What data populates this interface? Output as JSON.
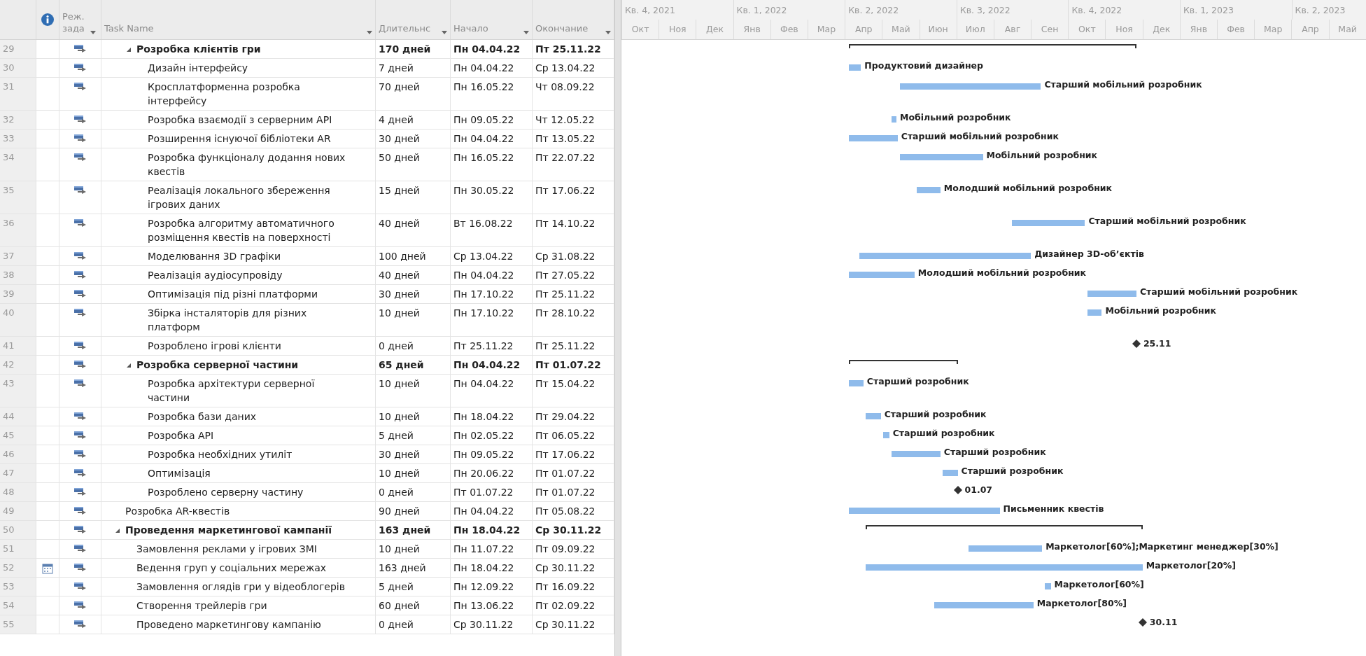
{
  "table": {
    "columns": [
      {
        "label": "Реж. зада",
        "dropdown": true
      },
      {
        "label": "Task Name",
        "dropdown": true
      },
      {
        "label": "Длительнс",
        "dropdown": true
      },
      {
        "label": "Начало",
        "dropdown": true
      },
      {
        "label": "Окончание",
        "dropdown": true
      }
    ]
  },
  "timeline": {
    "quarters": [
      "Кв. 4, 2021",
      "Кв. 1, 2022",
      "Кв. 2, 2022",
      "Кв. 3, 2022",
      "Кв. 4, 2022",
      "Кв. 1, 2023",
      "Кв. 2, 2023"
    ],
    "months": [
      "Окт",
      "Ноя",
      "Дек",
      "Янв",
      "Фев",
      "Мар",
      "Апр",
      "Май",
      "Июн",
      "Июл",
      "Авг",
      "Сен",
      "Окт",
      "Ноя",
      "Дек",
      "Янв",
      "Фев",
      "Мар",
      "Апр",
      "Май"
    ]
  },
  "tasks": [
    {
      "id": "29",
      "kind": "sub_summary",
      "expanded": true,
      "name": "Розробка клієнтів гри",
      "duration": "170 дней",
      "start": "Пн 04.04.22",
      "finish": "Пт 25.11.22",
      "children": [
        {
          "id": "30",
          "kind": "task",
          "name": "Дизайн інтерфейсу",
          "duration": "7 дней",
          "start": "Пн 04.04.22",
          "finish": "Ср 13.04.22",
          "bar_label": "Продуктовий дизайнер"
        },
        {
          "id": "31",
          "kind": "task",
          "name": "Кросплатформенна розробка інтерфейсу",
          "duration": "70 дней",
          "start": "Пн 16.05.22",
          "finish": "Чт 08.09.22",
          "bar_label": "Старший мобільний розробник"
        },
        {
          "id": "32",
          "kind": "task",
          "name": "Розробка взаємодії з серверним API",
          "duration": "4 дней",
          "start": "Пн 09.05.22",
          "finish": "Чт 12.05.22",
          "bar_label": "Мобільний розробник"
        },
        {
          "id": "33",
          "kind": "task",
          "name": "Розширення існуючої бібліотеки AR",
          "duration": "30 дней",
          "start": "Пн 04.04.22",
          "finish": "Пт 13.05.22",
          "bar_label": "Старший мобільний розробник"
        },
        {
          "id": "34",
          "kind": "task",
          "name": "Розробка функціоналу додання нових квестів",
          "duration": "50 дней",
          "start": "Пн 16.05.22",
          "finish": "Пт 22.07.22",
          "bar_label": "Мобільний розробник"
        },
        {
          "id": "35",
          "kind": "task",
          "name": "Реалізація локального збереження ігрових даних",
          "duration": "15 дней",
          "start": "Пн 30.05.22",
          "finish": "Пт 17.06.22",
          "bar_label": "Молодший мобільний розробник"
        },
        {
          "id": "36",
          "kind": "task",
          "name": "Розробка алгоритму автоматичного розміщення квестів на поверхності",
          "duration": "40 дней",
          "start": "Вт 16.08.22",
          "finish": "Пт 14.10.22",
          "bar_label": "Старший мобільний розробник"
        },
        {
          "id": "37",
          "kind": "task",
          "name": "Моделювання 3D графіки",
          "duration": "100 дней",
          "start": "Ср 13.04.22",
          "finish": "Ср 31.08.22",
          "bar_label": "Дизайнер 3D-об’єктів"
        },
        {
          "id": "38",
          "kind": "task",
          "name": "Реалізація аудіосупровіду",
          "duration": "40 дней",
          "start": "Пн 04.04.22",
          "finish": "Пт 27.05.22",
          "bar_label": "Молодший мобільний розробник"
        },
        {
          "id": "39",
          "kind": "task",
          "name": "Оптимізація під різні платформи",
          "duration": "30 дней",
          "start": "Пн 17.10.22",
          "finish": "Пт 25.11.22",
          "bar_label": "Старший мобільний розробник"
        },
        {
          "id": "40",
          "kind": "task",
          "name": "Збірка інсталяторів для різних платформ",
          "duration": "10 дней",
          "start": "Пн 17.10.22",
          "finish": "Пт 28.10.22",
          "bar_label": "Мобільний розробник"
        },
        {
          "id": "41",
          "kind": "milestone",
          "name": "Розроблено ігрові клієнти",
          "duration": "0 дней",
          "start": "Пт 25.11.22",
          "finish": "Пт 25.11.22",
          "bar_label": "25.11"
        }
      ]
    },
    {
      "id": "42",
      "kind": "sub_summary",
      "expanded": true,
      "name": "Розробка серверної частини",
      "duration": "65 дней",
      "start": "Пн 04.04.22",
      "finish": "Пт 01.07.22",
      "children": [
        {
          "id": "43",
          "kind": "task",
          "name": "Розробка архітектури серверної частини",
          "duration": "10 дней",
          "start": "Пн 04.04.22",
          "finish": "Пт 15.04.22",
          "bar_label": "Старший розробник"
        },
        {
          "id": "44",
          "kind": "task",
          "name": "Розробка бази даних",
          "duration": "10 дней",
          "start": "Пн 18.04.22",
          "finish": "Пт 29.04.22",
          "bar_label": "Старший розробник"
        },
        {
          "id": "45",
          "kind": "task",
          "name": "Розробка API",
          "duration": "5 дней",
          "start": "Пн 02.05.22",
          "finish": "Пт 06.05.22",
          "bar_label": "Старший розробник"
        },
        {
          "id": "46",
          "kind": "task",
          "name": "Розробка необхідних утиліт",
          "duration": "30 дней",
          "start": "Пн 09.05.22",
          "finish": "Пт 17.06.22",
          "bar_label": "Старший розробник"
        },
        {
          "id": "47",
          "kind": "task",
          "name": "Оптимізація",
          "duration": "10 дней",
          "start": "Пн 20.06.22",
          "finish": "Пт 01.07.22",
          "bar_label": "Старший розробник"
        },
        {
          "id": "48",
          "kind": "milestone",
          "name": "Розроблено серверну частину",
          "duration": "0 дней",
          "start": "Пт 01.07.22",
          "finish": "Пт 01.07.22",
          "bar_label": "01.07"
        }
      ]
    },
    {
      "id": "49",
      "kind": "task",
      "name": "Розробка AR-квестів",
      "duration": "90 дней",
      "start": "Пн 04.04.22",
      "finish": "Пт 05.08.22",
      "bar_label": "Письменник квестів"
    },
    {
      "id": "50",
      "kind": "summary",
      "expanded": true,
      "name": "Проведення маркетингової кампанії",
      "duration": "163 дней",
      "start": "Пн 18.04.22",
      "finish": "Ср 30.11.22",
      "children": [
        {
          "id": "51",
          "kind": "task",
          "name": "Замовлення реклами у ігрових ЗМІ",
          "duration": "10 дней",
          "start": "Пн 11.07.22",
          "finish": "Пт 09.09.22",
          "bar_label": "Маркетолог[60%];Маркетинг менеджер[30%]"
        },
        {
          "id": "52",
          "kind": "task",
          "calendar_indicator": true,
          "name": "Ведення груп у соціальних мережах",
          "duration": "163 дней",
          "start": "Пн 18.04.22",
          "finish": "Ср 30.11.22",
          "bar_label": "Маркетолог[20%]"
        },
        {
          "id": "53",
          "kind": "task",
          "name": "Замовлення оглядів гри у відеоблогерів",
          "duration": "5 дней",
          "start": "Пн 12.09.22",
          "finish": "Пт 16.09.22",
          "bar_label": "Маркетолог[60%]"
        },
        {
          "id": "54",
          "kind": "task",
          "name": "Створення трейлерів гри",
          "duration": "60 дней",
          "start": "Пн 13.06.22",
          "finish": "Пт 02.09.22",
          "bar_label": "Маркетолог[80%]"
        },
        {
          "id": "55",
          "kind": "milestone",
          "name": "Проведено маркетингову кампанію",
          "duration": "0 дней",
          "start": "Ср 30.11.22",
          "finish": "Ср 30.11.22",
          "bar_label": "30.11"
        }
      ]
    }
  ]
}
